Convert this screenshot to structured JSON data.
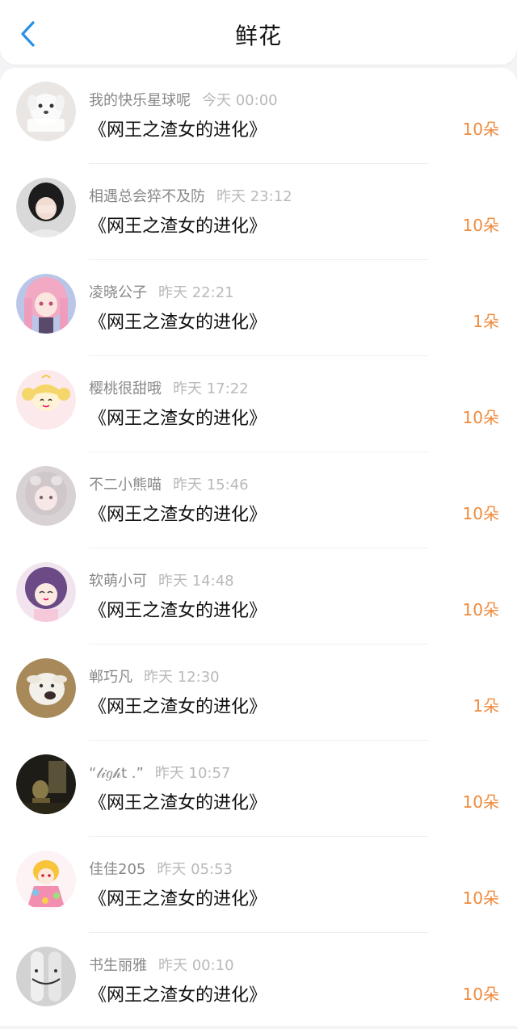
{
  "header": {
    "title": "鲜花",
    "back_icon": "chevron-left-icon",
    "accent": "#2a8fe6"
  },
  "colors": {
    "flower_count": "#f08a3c",
    "name": "#888888",
    "time": "#b9b9b9"
  },
  "items": [
    {
      "name": "我的快乐星球呢",
      "time": "今天 00:00",
      "book": "《网王之渣女的进化》",
      "flowers": "10朵",
      "avatar": "avatar-white-dog"
    },
    {
      "name": "相遇总会猝不及防",
      "time": "昨天 23:12",
      "book": "《网王之渣女的进化》",
      "flowers": "10朵",
      "avatar": "avatar-girl-covering-face"
    },
    {
      "name": "凌晓公子",
      "time": "昨天 22:21",
      "book": "《网王之渣女的进化》",
      "flowers": "1朵",
      "avatar": "avatar-pink-anime-girl"
    },
    {
      "name": "樱桃很甜哦",
      "time": "昨天 17:22",
      "book": "《网王之渣女的进化》",
      "flowers": "10朵",
      "avatar": "avatar-sailor-moon"
    },
    {
      "name": "不二小熊喵",
      "time": "昨天 15:46",
      "book": "《网王之渣女的进化》",
      "flowers": "10朵",
      "avatar": "avatar-gray-hair-girl"
    },
    {
      "name": "软萌小可",
      "time": "昨天 14:48",
      "book": "《网王之渣女的进化》",
      "flowers": "10朵",
      "avatar": "avatar-purple-hair-girl"
    },
    {
      "name": "郸巧凡",
      "time": "昨天 12:30",
      "book": "《网王之渣女的进化》",
      "flowers": "1朵",
      "avatar": "avatar-goat"
    },
    {
      "name": "“𝓁𝒾𝑔𝒽t .”",
      "time": "昨天 10:57",
      "book": "《网王之渣女的进化》",
      "flowers": "10朵",
      "avatar": "avatar-dark-silhouette"
    },
    {
      "name": "佳佳205",
      "time": "昨天 05:53",
      "book": "《网王之渣女的进化》",
      "flowers": "10朵",
      "avatar": "avatar-colorful-anime"
    },
    {
      "name": "书生丽雅",
      "time": "昨天 00:10",
      "book": "《网王之渣女的进化》",
      "flowers": "10朵",
      "avatar": "avatar-smiley-fingers"
    }
  ]
}
